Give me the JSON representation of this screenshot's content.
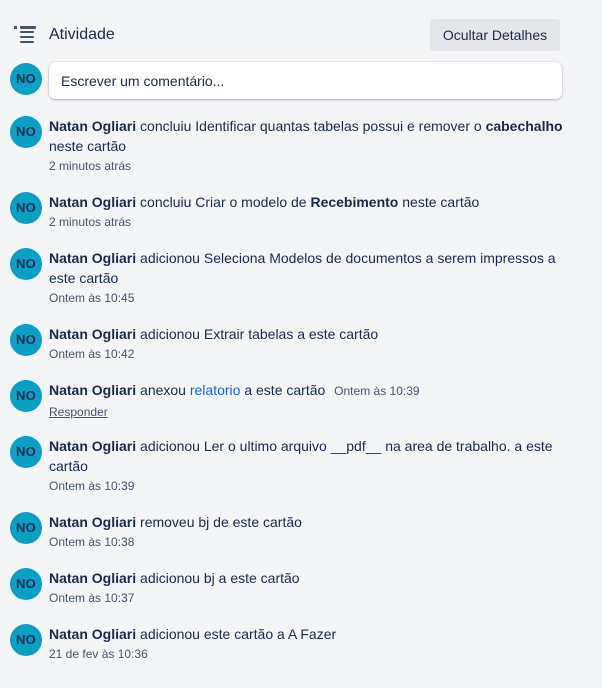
{
  "header": {
    "title": "Atividade",
    "hide_details": "Ocultar Detalhes",
    "icon": "activity-list-icon"
  },
  "comment": {
    "avatar": "NO",
    "placeholder": "Escrever um comentário..."
  },
  "colors": {
    "avatar_bg": "#0aa0c5",
    "link": "#0c66e4",
    "background": "#f4f5f7"
  },
  "activities": [
    {
      "avatar": "NO",
      "user": "Natan Ogliari",
      "action": "concluiu Identificar quantas tabelas possui e remover o",
      "bold": "cabechalho",
      "suffix": "neste cartão",
      "time": "2 minutos atrás"
    },
    {
      "avatar": "NO",
      "user": "Natan Ogliari",
      "action": "concluiu Criar o modelo de",
      "bold": "Recebimento",
      "suffix": "neste cartão",
      "time": "2 minutos atrás"
    },
    {
      "avatar": "NO",
      "user": "Natan Ogliari",
      "action": "adicionou Seleciona Modelos de documentos a serem impressos a este cartão",
      "time": "Ontem às 10:45"
    },
    {
      "avatar": "NO",
      "user": "Natan Ogliari",
      "action": "adicionou Extrair tabelas a este cartão",
      "time": "Ontem às 10:42"
    },
    {
      "avatar": "NO",
      "user": "Natan Ogliari",
      "action": "anexou",
      "link": "relatorio",
      "suffix": "a este cartão",
      "time": "Ontem às 10:39",
      "reply": "Responder"
    },
    {
      "avatar": "NO",
      "user": "Natan Ogliari",
      "action": "adicionou Ler o ultimo arquivo __pdf__ na area de trabalho. a este cartão",
      "time": "Ontem às 10:39"
    },
    {
      "avatar": "NO",
      "user": "Natan Ogliari",
      "action": "removeu bj de este cartão",
      "time": "Ontem às 10:38"
    },
    {
      "avatar": "NO",
      "user": "Natan Ogliari",
      "action": "adicionou bj a este cartão",
      "time": "Ontem às 10:37"
    },
    {
      "avatar": "NO",
      "user": "Natan Ogliari",
      "action": "adicionou este cartão a A Fazer",
      "time": "21 de fev às 10:36"
    }
  ]
}
